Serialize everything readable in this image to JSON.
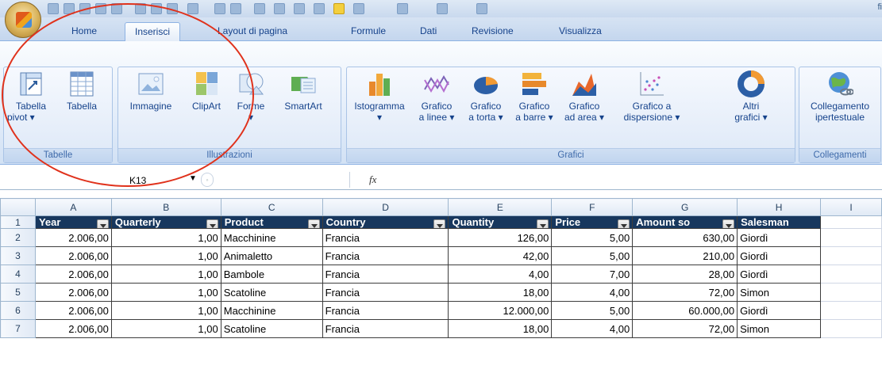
{
  "quick_access": {
    "title_fragment": "fi"
  },
  "tabs": [
    {
      "label": "Home"
    },
    {
      "label": "Inserisci"
    },
    {
      "label": "Layout di pagina"
    },
    {
      "label": "Formule"
    },
    {
      "label": "Dati"
    },
    {
      "label": "Revisione"
    },
    {
      "label": "Visualizza"
    }
  ],
  "groups": {
    "tabelle": {
      "label": "Tabelle",
      "buttons": [
        {
          "line1": "Tabella",
          "line2": "pivot ▾",
          "icon": "pivot-table-icon"
        },
        {
          "line1": "Tabella",
          "line2": "",
          "icon": "table-icon"
        }
      ]
    },
    "illustrazioni": {
      "label": "Illustrazioni",
      "buttons": [
        {
          "line1": "Immagine",
          "line2": "",
          "icon": "picture-icon"
        },
        {
          "line1": "ClipArt",
          "line2": "",
          "icon": "clipart-icon"
        },
        {
          "line1": "Forme",
          "line2": "▾",
          "icon": "shapes-icon"
        },
        {
          "line1": "SmartArt",
          "line2": "",
          "icon": "smartart-icon"
        }
      ]
    },
    "grafici": {
      "label": "Grafici",
      "buttons": [
        {
          "line1": "Istogramma",
          "line2": "▾",
          "icon": "column-chart-icon"
        },
        {
          "line1": "Grafico",
          "line2": "a linee ▾",
          "icon": "line-chart-icon"
        },
        {
          "line1": "Grafico",
          "line2": "a torta ▾",
          "icon": "pie-chart-icon"
        },
        {
          "line1": "Grafico",
          "line2": "a barre ▾",
          "icon": "bar-chart-icon"
        },
        {
          "line1": "Grafico",
          "line2": "ad area ▾",
          "icon": "area-chart-icon"
        },
        {
          "line1": "Grafico a",
          "line2": "dispersione ▾",
          "icon": "scatter-chart-icon"
        },
        {
          "line1": "Altri",
          "line2": "grafici ▾",
          "icon": "other-charts-icon"
        }
      ]
    },
    "collegamenti": {
      "label": "Collegamenti",
      "buttons": [
        {
          "line1": "Collegamento",
          "line2": "ipertestuale",
          "icon": "hyperlink-globe-icon"
        }
      ]
    }
  },
  "formula_bar": {
    "name_box": "K13",
    "fx": "fx"
  },
  "columns": [
    "A",
    "B",
    "C",
    "D",
    "E",
    "F",
    "G",
    "H",
    "I"
  ],
  "header_row": [
    "Year",
    "Quarterly",
    "Product",
    "Country",
    "Quantity",
    "Price",
    "Amount so",
    "Salesman"
  ],
  "rows": [
    {
      "n": "1"
    },
    {
      "n": "2",
      "cells": [
        "2.006,00",
        "1,00",
        "Macchinine",
        "Francia",
        "126,00",
        "5,00",
        "630,00",
        "Giordì"
      ]
    },
    {
      "n": "3",
      "cells": [
        "2.006,00",
        "1,00",
        "Animaletto",
        "Francia",
        "42,00",
        "5,00",
        "210,00",
        "Giordì"
      ]
    },
    {
      "n": "4",
      "cells": [
        "2.006,00",
        "1,00",
        "Bambole",
        "Francia",
        "4,00",
        "7,00",
        "28,00",
        "Giordì"
      ]
    },
    {
      "n": "5",
      "cells": [
        "2.006,00",
        "1,00",
        "Scatoline",
        "Francia",
        "18,00",
        "4,00",
        "72,00",
        "Simon"
      ]
    },
    {
      "n": "6",
      "cells": [
        "2.006,00",
        "1,00",
        "Macchinine",
        "Francia",
        "12.000,00",
        "5,00",
        "60.000,00",
        "Giordì"
      ]
    },
    {
      "n": "7",
      "cells": [
        "2.006,00",
        "1,00",
        "Scatoline",
        "Francia",
        "18,00",
        "4,00",
        "72,00",
        "Simon"
      ]
    }
  ],
  "colors": {
    "header_fill": "#17375e",
    "annotation_circle": "#e0321c",
    "ribbon_text": "#15428b"
  }
}
